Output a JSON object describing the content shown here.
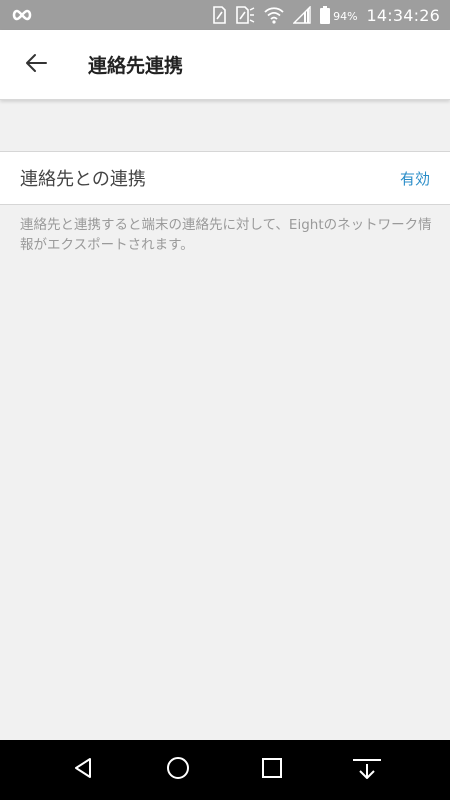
{
  "status_bar": {
    "battery_percent": "94%",
    "time": "14:34:26",
    "icons": [
      "infinity-icon",
      "sim-icon",
      "notification-icon",
      "wifi-icon",
      "signal-icon",
      "battery-icon"
    ]
  },
  "app_bar": {
    "title": "連絡先連携",
    "back_icon": "arrow-left-icon"
  },
  "setting": {
    "label": "連絡先との連携",
    "value": "有効",
    "description": "連絡先と連携すると端末の連絡先に対して、Eightのネットワーク情報がエクスポートされます。"
  },
  "nav_bar": {
    "icons": [
      "back-triangle-icon",
      "home-circle-icon",
      "recents-square-icon",
      "download-icon"
    ]
  },
  "colors": {
    "status_bar": "#9e9e9e",
    "background": "#f1f1f1",
    "accent": "#2a8dc8",
    "description_text": "#9a9a9a"
  }
}
